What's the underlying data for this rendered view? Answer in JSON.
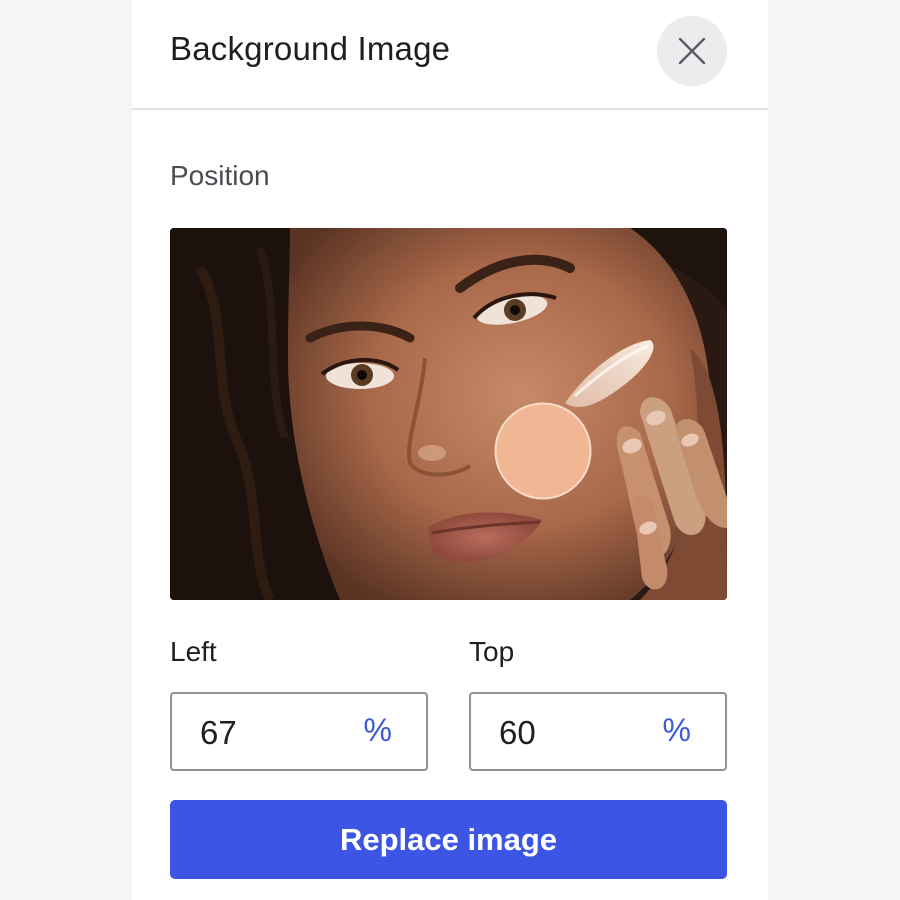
{
  "panel": {
    "title": "Background Image"
  },
  "position": {
    "section_label": "Position",
    "image_alt": "Portrait of a woman applying cream to her cheek",
    "focal_point": {
      "left_pct": 67,
      "top_pct": 60
    },
    "focal_color": "#f1b794"
  },
  "fields": {
    "left": {
      "label": "Left",
      "value": "67",
      "unit": "%"
    },
    "top": {
      "label": "Top",
      "value": "60",
      "unit": "%"
    }
  },
  "actions": {
    "replace_label": "Replace image"
  },
  "colors": {
    "accent": "#3c55e4",
    "unit_text": "#3d59d6",
    "divider": "#e1e2e5"
  }
}
